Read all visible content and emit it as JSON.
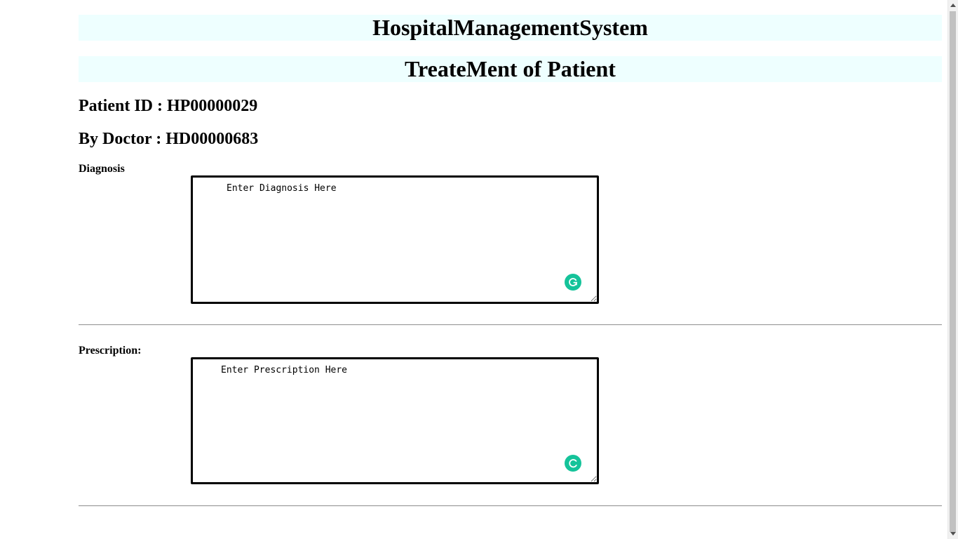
{
  "header": {
    "title": "HospitalManagementSystem",
    "subtitle": "TreateMent of Patient"
  },
  "patient": {
    "id_text": "Patient ID : HP00000029",
    "doctor_text": "By Doctor : HD00000683"
  },
  "diagnosis": {
    "label": "Diagnosis",
    "placeholder": "Enter Diagnosis Here",
    "value": ""
  },
  "prescription": {
    "label": "Prescription:",
    "placeholder": "Enter Prescription Here",
    "value": ""
  },
  "icons": {
    "grammar_icon": "grammarly-icon",
    "grammar_color": "#15c39a"
  },
  "colors": {
    "banner_bg": "#eeffff"
  }
}
